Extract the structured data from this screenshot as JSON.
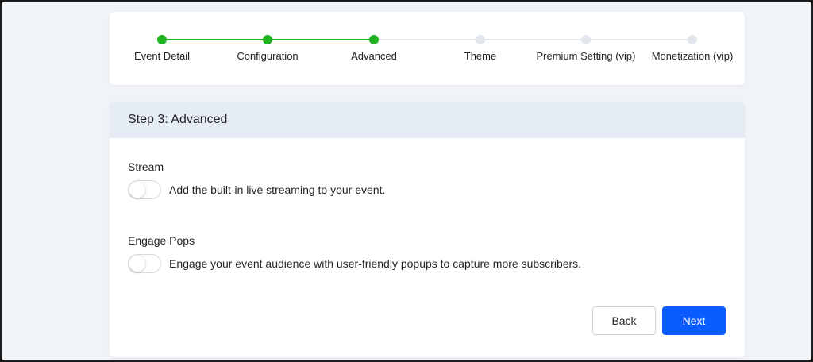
{
  "stepper": {
    "steps": [
      {
        "label": "Event Detail",
        "done": true
      },
      {
        "label": "Configuration",
        "done": true
      },
      {
        "label": "Advanced",
        "done": true
      },
      {
        "label": "Theme",
        "done": false
      },
      {
        "label": "Premium Setting (vip)",
        "done": false
      },
      {
        "label": "Monetization (vip)",
        "done": false
      }
    ]
  },
  "panel": {
    "title": "Step 3: Advanced",
    "stream": {
      "title": "Stream",
      "description": "Add the built-in live streaming to your event.",
      "enabled": false
    },
    "engage_pops": {
      "title": "Engage Pops",
      "description": "Engage your event audience with user-friendly popups to capture more subscribers.",
      "enabled": false
    },
    "back_label": "Back",
    "next_label": "Next"
  },
  "colors": {
    "step_done": "#1fb41f",
    "step_pending": "#e2e7ee",
    "primary": "#0b5cff",
    "header_bg": "#e6ecf4"
  }
}
